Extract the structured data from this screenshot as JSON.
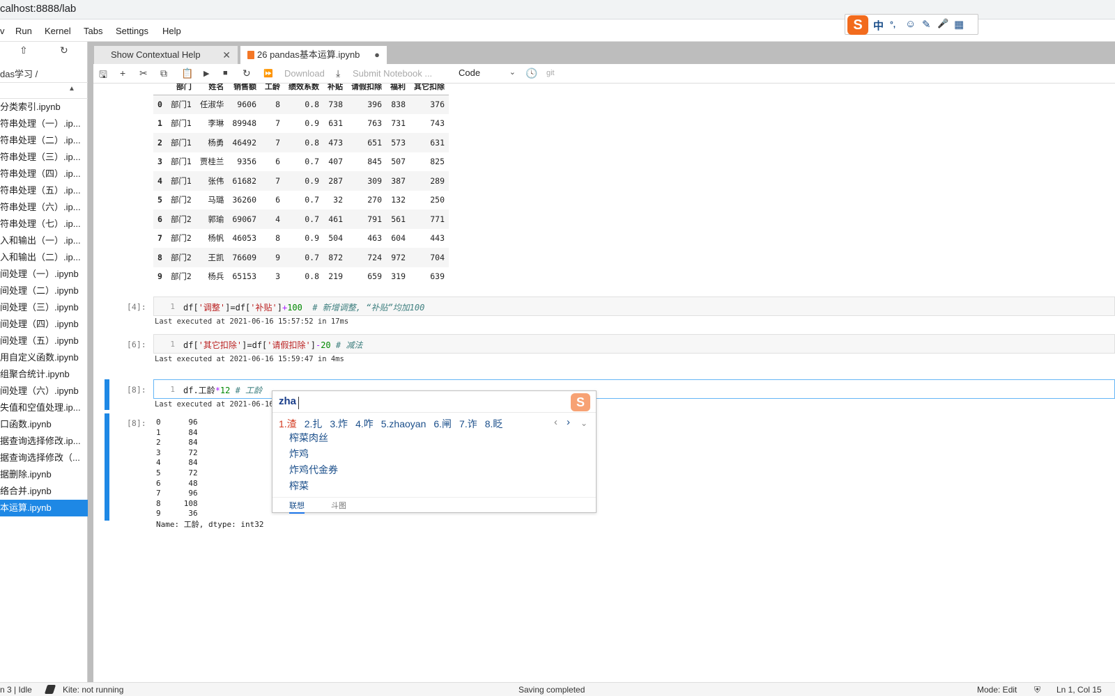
{
  "browser": {
    "url": "calhost:8888/lab"
  },
  "menubar": {
    "items": [
      "v",
      "Run",
      "Kernel",
      "Tabs",
      "Settings",
      "Help"
    ]
  },
  "ime_toolbar": {
    "logo": "S",
    "items": [
      "中",
      "°,",
      "☺",
      "✎",
      "🎤",
      "▦"
    ]
  },
  "sidebar": {
    "breadcrumb": "das学习 /",
    "files": [
      "分类索引.ipynb",
      "符串处理（一）.ip...",
      "符串处理（二）.ip...",
      "符串处理（三）.ip...",
      "符串处理（四）.ip...",
      "符串处理（五）.ip...",
      "符串处理（六）.ip...",
      "符串处理（七）.ip...",
      "入和输出（一）.ip...",
      "入和输出（二）.ip...",
      "间处理（一）.ipynb",
      "间处理（二）.ipynb",
      "间处理（三）.ipynb",
      "间处理（四）.ipynb",
      "间处理（五）.ipynb",
      "用自定义函数.ipynb",
      "组聚合统计.ipynb",
      "间处理（六）.ipynb",
      "失值和空值处理.ip...",
      "口函数.ipynb",
      "据查询选择修改.ip...",
      "据查询选择修改（...",
      "据删除.ipynb",
      "络合并.ipynb",
      "本运算.ipynb"
    ],
    "selected_index": 24
  },
  "tabs": [
    {
      "label": "Show Contextual Help",
      "active": false
    },
    {
      "label": "26 pandas基本运算.ipynb",
      "active": true
    }
  ],
  "toolbar": {
    "download": "Download",
    "submit": "Submit Notebook ...",
    "cell_type": "Code",
    "git": "git"
  },
  "dataframe": {
    "columns": [
      "",
      "部门",
      "姓名",
      "销售额",
      "工龄",
      "绩效系数",
      "补贴",
      "请假扣除",
      "福利",
      "其它扣除"
    ],
    "rows": [
      [
        "0",
        "部门1",
        "任淑华",
        "9606",
        "8",
        "0.8",
        "738",
        "396",
        "838",
        "376"
      ],
      [
        "1",
        "部门1",
        "李琳",
        "89948",
        "7",
        "0.9",
        "631",
        "763",
        "731",
        "743"
      ],
      [
        "2",
        "部门1",
        "杨勇",
        "46492",
        "7",
        "0.8",
        "473",
        "651",
        "573",
        "631"
      ],
      [
        "3",
        "部门1",
        "贾桂兰",
        "9356",
        "6",
        "0.7",
        "407",
        "845",
        "507",
        "825"
      ],
      [
        "4",
        "部门1",
        "张伟",
        "61682",
        "7",
        "0.9",
        "287",
        "309",
        "387",
        "289"
      ],
      [
        "5",
        "部门2",
        "马璐",
        "36260",
        "6",
        "0.7",
        "32",
        "270",
        "132",
        "250"
      ],
      [
        "6",
        "部门2",
        "郭瑜",
        "69067",
        "4",
        "0.7",
        "461",
        "791",
        "561",
        "771"
      ],
      [
        "7",
        "部门2",
        "杨帆",
        "46053",
        "8",
        "0.9",
        "504",
        "463",
        "604",
        "443"
      ],
      [
        "8",
        "部门2",
        "王凯",
        "76609",
        "9",
        "0.7",
        "872",
        "724",
        "972",
        "704"
      ],
      [
        "9",
        "部门2",
        "杨兵",
        "65153",
        "3",
        "0.8",
        "219",
        "659",
        "319",
        "639"
      ]
    ]
  },
  "cells": [
    {
      "prompt": "[4]:",
      "line": "1",
      "code_parts": [
        {
          "t": "df[",
          "c": ""
        },
        {
          "t": "'调整'",
          "c": "str"
        },
        {
          "t": "]=df[",
          "c": ""
        },
        {
          "t": "'补贴'",
          "c": "str"
        },
        {
          "t": "]",
          "c": ""
        },
        {
          "t": "+",
          "c": "op"
        },
        {
          "t": "100",
          "c": "num"
        },
        {
          "t": "  # 新增调整, “补贴”均加100",
          "c": "cmt"
        }
      ],
      "exec": "Last executed at 2021-06-16 15:57:52 in 17ms"
    },
    {
      "prompt": "[6]:",
      "line": "1",
      "code_parts": [
        {
          "t": "df[",
          "c": ""
        },
        {
          "t": "'其它扣除'",
          "c": "str"
        },
        {
          "t": "]=df[",
          "c": ""
        },
        {
          "t": "'请假扣除'",
          "c": "str"
        },
        {
          "t": "]",
          "c": ""
        },
        {
          "t": "-",
          "c": "op"
        },
        {
          "t": "20",
          "c": "num"
        },
        {
          "t": " # 减法",
          "c": "cmt"
        }
      ],
      "exec": "Last executed at 2021-06-16 15:59:47 in 4ms"
    },
    {
      "prompt": "[8]:",
      "line": "1",
      "code_parts": [
        {
          "t": "df.工龄",
          "c": ""
        },
        {
          "t": "*",
          "c": "op"
        },
        {
          "t": "12",
          "c": "num"
        },
        {
          "t": " # 工龄",
          "c": "cmt"
        }
      ],
      "exec": "Last executed at 2021-06-16"
    }
  ],
  "output": {
    "prompt": "[8]:",
    "rows": [
      "0      96",
      "1      84",
      "2      84",
      "3      72",
      "4      84",
      "5      72",
      "6      48",
      "7      96",
      "8     108",
      "9      36"
    ],
    "footer": "Name: 工龄, dtype: int32"
  },
  "ime_popup": {
    "pinyin": "zha",
    "logo": "S",
    "candidates": [
      "1.渣",
      "2.扎",
      "3.炸",
      "4.咋",
      "5.zhaoyan",
      "6.闸",
      "7.诈",
      "8.眨"
    ],
    "associations": [
      "榨菜肉丝",
      "炸鸡",
      "炸鸡代金券",
      "榨菜"
    ],
    "footer_tabs": [
      "联想",
      "斗图"
    ]
  },
  "status": {
    "left": "n 3 | Idle",
    "kite": "Kite: not running",
    "center": "Saving completed",
    "mode": "Mode: Edit",
    "position": "Ln 1, Col 15"
  }
}
